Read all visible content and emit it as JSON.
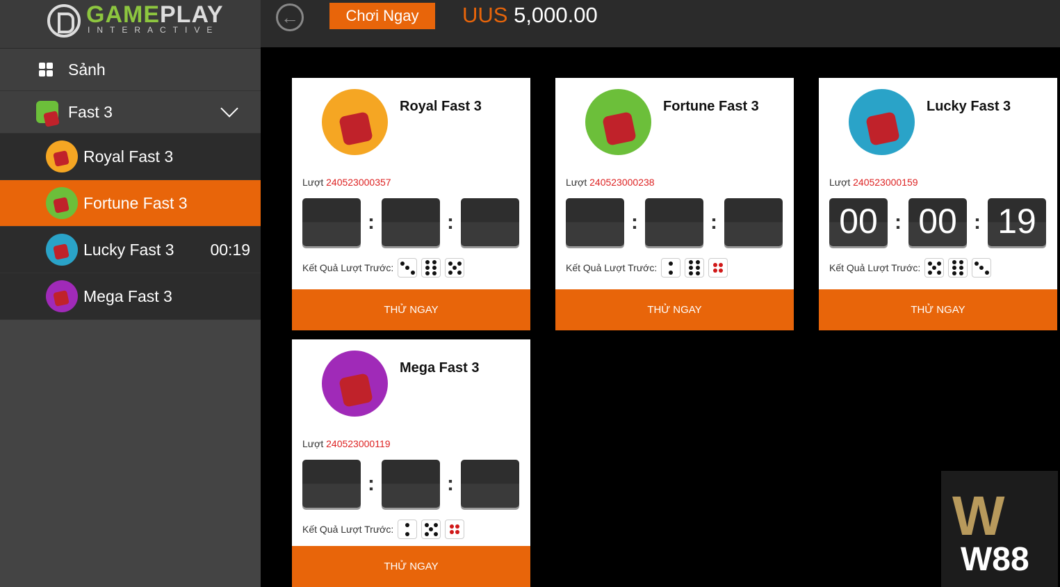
{
  "logo": {
    "brand_a": "GAME",
    "brand_b": "PLAY",
    "sub": "INTERACTIVE"
  },
  "header": {
    "play_now": "Chơi Ngay",
    "currency": "UUS",
    "balance": "5,000.00",
    "back_icon": "arrow-left-circle-icon"
  },
  "sidebar": {
    "lobby": "Sảnh",
    "group": "Fast 3",
    "items": [
      {
        "label": "Royal Fast 3",
        "color": "#f5a623",
        "active": false,
        "timer": ""
      },
      {
        "label": "Fortune Fast 3",
        "color": "#6cbf3a",
        "active": true,
        "timer": ""
      },
      {
        "label": "Lucky Fast 3",
        "color": "#2aa3c8",
        "active": false,
        "timer": "00:19"
      },
      {
        "label": "Mega Fast 3",
        "color": "#a02ab8",
        "active": false,
        "timer": ""
      }
    ]
  },
  "colors": {
    "accent": "#e8650a",
    "round": "#dd2222"
  },
  "cards": [
    {
      "title": "Royal Fast 3",
      "round_label": "Lượt",
      "round": "240523000357",
      "timer": [
        "",
        "",
        ""
      ],
      "result_label": "Kết Quả Lượt Trước:",
      "dice": [
        3,
        6,
        5
      ],
      "button": "THỬ NGAY",
      "color": "#f5a623"
    },
    {
      "title": "Fortune Fast 3",
      "round_label": "Lượt",
      "round": "240523000238",
      "timer": [
        "",
        "",
        ""
      ],
      "result_label": "Kết Quả Lượt Trước:",
      "dice": [
        2,
        6,
        4
      ],
      "button": "THỬ NGAY",
      "color": "#6cbf3a"
    },
    {
      "title": "Lucky Fast 3",
      "round_label": "Lượt",
      "round": "240523000159",
      "timer": [
        "00",
        "00",
        "19"
      ],
      "result_label": "Kết Quả Lượt Trước:",
      "dice": [
        5,
        6,
        3
      ],
      "button": "THỬ NGAY",
      "color": "#2aa3c8"
    },
    {
      "title": "Mega Fast 3",
      "round_label": "Lượt",
      "round": "240523000119",
      "timer": [
        "",
        "",
        ""
      ],
      "result_label": "Kết Quả Lượt Trước:",
      "dice": [
        2,
        5,
        4
      ],
      "button": "THỬ NGAY",
      "color": "#a02ab8"
    }
  ],
  "watermark": {
    "text": "W88"
  }
}
